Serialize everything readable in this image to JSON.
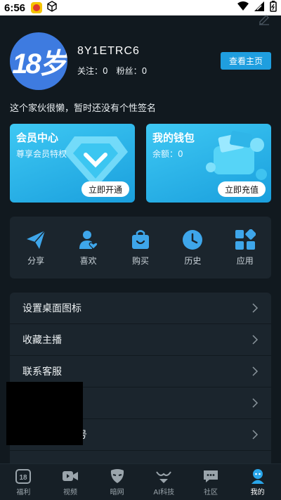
{
  "status_bar": {
    "time": "6:56"
  },
  "profile": {
    "avatar_text": "18岁",
    "username": "8Y1ETRC6",
    "follow_label": "关注：0",
    "fans_label": "粉丝：0",
    "homepage_button": "查看主页",
    "signature": "这个家伙很懒，暂时还没有个性签名"
  },
  "cards": {
    "vip": {
      "title": "会员中心",
      "subtitle": "尊享会员特权",
      "button": "立即开通"
    },
    "wallet": {
      "title": "我的钱包",
      "balance": "余额：0",
      "button": "立即充值"
    }
  },
  "shortcuts": [
    {
      "label": "分享",
      "icon": "paper-plane-icon"
    },
    {
      "label": "喜欢",
      "icon": "user-heart-icon"
    },
    {
      "label": "购买",
      "icon": "shopping-bag-icon"
    },
    {
      "label": "历史",
      "icon": "clock-icon"
    },
    {
      "label": "应用",
      "icon": "apps-icon"
    }
  ],
  "menu": [
    {
      "label": "设置桌面图标"
    },
    {
      "label": "收藏主播"
    },
    {
      "label": "联系客服"
    },
    {
      "label": ""
    },
    {
      "label": "号"
    },
    {
      "label": ""
    }
  ],
  "tabs": [
    {
      "label": "福利",
      "icon": "welfare-18-icon"
    },
    {
      "label": "视频",
      "icon": "video-camera-icon"
    },
    {
      "label": "暗网",
      "icon": "mask-icon"
    },
    {
      "label": "AI科技",
      "icon": "ai-bikini-icon"
    },
    {
      "label": "社区",
      "icon": "chat-bubble-icon"
    },
    {
      "label": "我的",
      "icon": "profile-icon"
    }
  ],
  "colors": {
    "accent": "#1f9edf",
    "card_gradient_start": "#3ec8f3",
    "background": "#11191f",
    "panel": "#1b252d"
  }
}
